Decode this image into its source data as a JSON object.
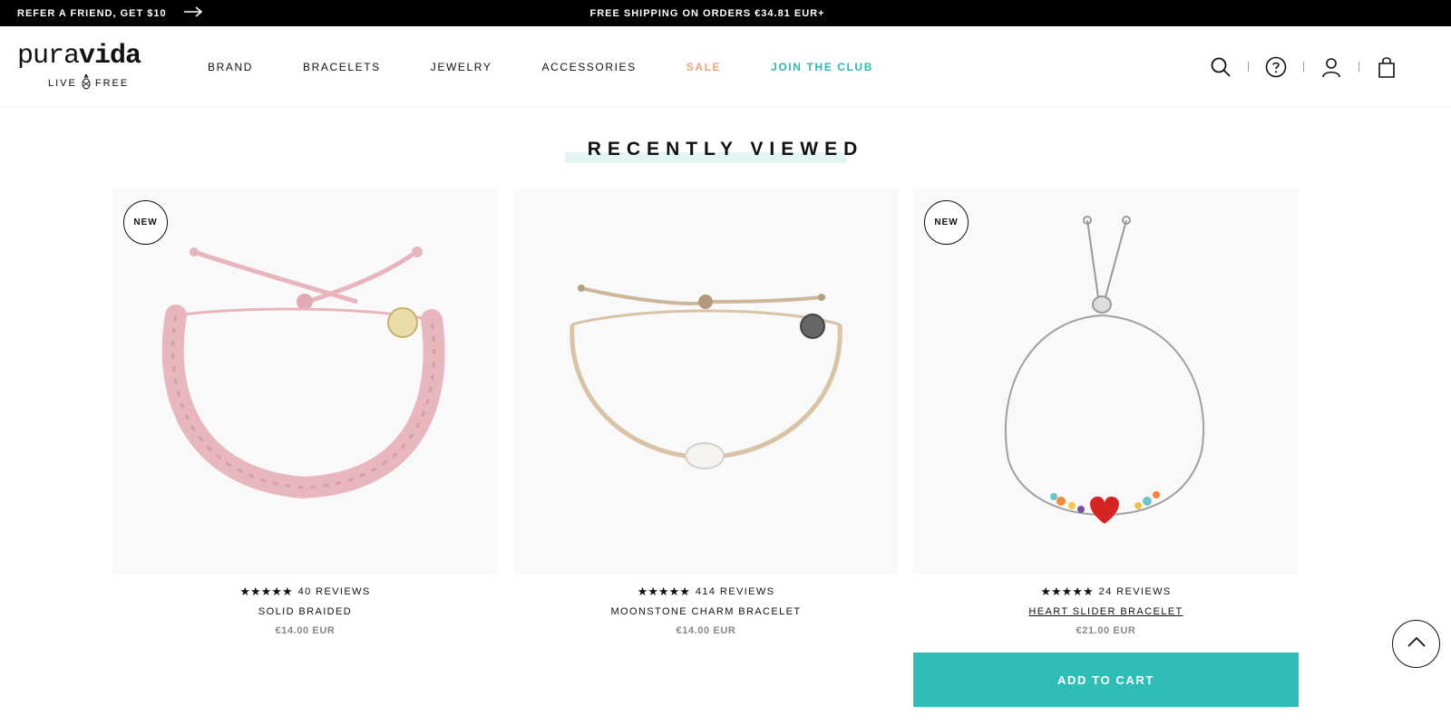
{
  "announcement": {
    "refer_label": "REFER A FRIEND, GET $10",
    "shipping_text": "FREE SHIPPING ON ORDERS €34.81 EUR+"
  },
  "brand": {
    "wordmark_light": "pura",
    "wordmark_bold": "vida",
    "tag_left": "LIVE",
    "tag_right": "FREE"
  },
  "nav": {
    "items": [
      {
        "label": "BRAND"
      },
      {
        "label": "BRACELETS"
      },
      {
        "label": "JEWELRY"
      },
      {
        "label": "ACCESSORIES"
      },
      {
        "label": "SALE"
      },
      {
        "label": "JOIN THE CLUB"
      }
    ]
  },
  "tools": {
    "icons": [
      "search-icon",
      "help-icon",
      "account-icon",
      "cart-icon"
    ]
  },
  "section": {
    "title": "RECENTLY VIEWED"
  },
  "products": [
    {
      "badge": "NEW",
      "stars": "★★★★★",
      "reviews": "40 REVIEWS",
      "name": "SOLID BRAIDED",
      "price": "€14.00 EUR"
    },
    {
      "badge": "",
      "stars": "★★★★★",
      "reviews": "414 REVIEWS",
      "name": "MOONSTONE CHARM BRACELET",
      "price": "€14.00 EUR"
    },
    {
      "badge": "NEW",
      "stars": "★★★★★",
      "reviews": "24 REVIEWS",
      "name": "HEART SLIDER BRACELET",
      "price": "€21.00 EUR"
    }
  ],
  "cart": {
    "add_label": "ADD TO CART"
  },
  "colors": {
    "sale": "#f0a37a",
    "club": "#2cb9b3",
    "add_to_cart": "#2fbdb8",
    "heading_highlight": "#e3f6f4"
  }
}
